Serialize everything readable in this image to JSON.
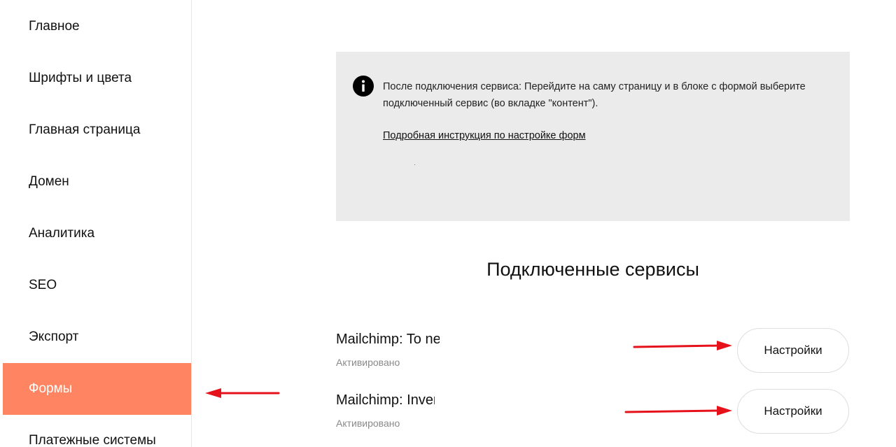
{
  "sidebar": {
    "items": [
      {
        "label": "Главное"
      },
      {
        "label": "Шрифты и цвета"
      },
      {
        "label": "Главная страница"
      },
      {
        "label": "Домен"
      },
      {
        "label": "Аналитика"
      },
      {
        "label": "SEO"
      },
      {
        "label": "Экспорт"
      },
      {
        "label": "Формы",
        "active": true
      },
      {
        "label": "Платежные системы"
      }
    ],
    "active_color": "#ff8562"
  },
  "info": {
    "icon": "info-icon",
    "text": "После подключения сервиса: Перейдите на саму страницу и в блоке с формой выберите подключенный сервис (во вкладке \"контент\").",
    "link": "Подробная инструкция по настройке форм"
  },
  "connected": {
    "title": "Подключенные сервисы",
    "services": [
      {
        "name": "Mailchimp: To ne",
        "status": "Активировано",
        "button": "Настройки"
      },
      {
        "name": "Mailchimp: Inver",
        "status": "Активировано",
        "button": "Настройки"
      }
    ]
  },
  "annotations": {
    "arrow_color": "#e5111b"
  }
}
